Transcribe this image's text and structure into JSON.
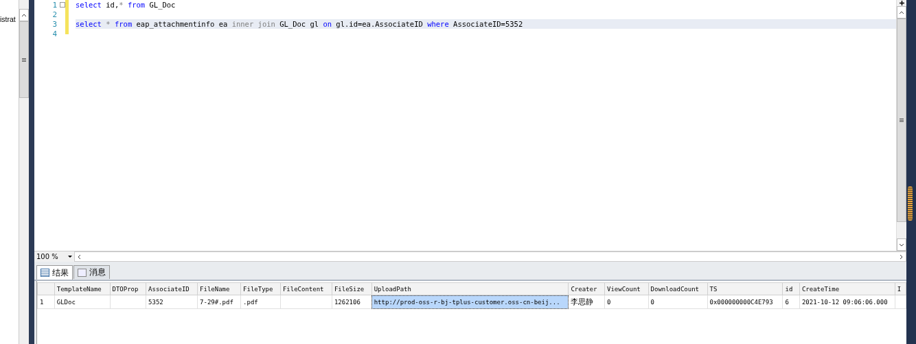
{
  "explorer": {
    "node_text": "istrat"
  },
  "editor": {
    "lines": [
      {
        "number": "1",
        "collapsible": true,
        "current": false,
        "tokens": [
          {
            "kind": "keyword",
            "text": "select"
          },
          {
            "kind": "plain",
            "text": " id,"
          },
          {
            "kind": "operator",
            "text": "* "
          },
          {
            "kind": "keyword",
            "text": "from"
          },
          {
            "kind": "plain",
            "text": " GL_Doc"
          }
        ]
      },
      {
        "number": "2",
        "collapsible": false,
        "current": false
      },
      {
        "number": "3",
        "collapsible": false,
        "current": true,
        "tokens": [
          {
            "kind": "keyword",
            "text": "select "
          },
          {
            "kind": "operator",
            "text": "* "
          },
          {
            "kind": "keyword",
            "text": "from"
          },
          {
            "kind": "plain",
            "text": " eap_attachmentinfo ea "
          },
          {
            "kind": "operator",
            "text": "inner join"
          },
          {
            "kind": "plain",
            "text": " GL_Doc gl "
          },
          {
            "kind": "keyword",
            "text": "on"
          },
          {
            "kind": "plain",
            "text": " gl.id=ea.AssociateID "
          },
          {
            "kind": "keyword",
            "text": "where"
          },
          {
            "kind": "plain",
            "text": " AssociateID=5352"
          }
        ]
      },
      {
        "number": "4",
        "collapsible": false,
        "current": false
      }
    ],
    "zoom": "100 %"
  },
  "result_tabs": [
    {
      "label": "结果",
      "kind": "grid",
      "selected": true
    },
    {
      "label": "消息",
      "kind": "messages",
      "selected": false
    }
  ],
  "grid": {
    "columns": [
      "TemplateName",
      "DTOProp",
      "AssociateID",
      "FileName",
      "FileType",
      "FileContent",
      "FileSize",
      "UploadPath",
      "Creater",
      "ViewCount",
      "DownloadCount",
      "TS",
      "id",
      "CreateTime",
      "I"
    ],
    "rows": [
      {
        "number": "1",
        "cells": [
          {
            "text": "GLDoc",
            "selected": false
          },
          {
            "text": "",
            "selected": false
          },
          {
            "text": "5352",
            "selected": false
          },
          {
            "text": "7-29#.pdf",
            "selected": false
          },
          {
            "text": ".pdf",
            "selected": false
          },
          {
            "text": "",
            "selected": false
          },
          {
            "text": "1262106",
            "selected": false
          },
          {
            "text": "http://prod-oss-r-bj-tplus-customer.oss-cn-beij...",
            "selected": true
          },
          {
            "text": "李思静",
            "selected": false
          },
          {
            "text": "0",
            "selected": false
          },
          {
            "text": "0",
            "selected": false
          },
          {
            "text": "0x000000000C4E793",
            "selected": false
          },
          {
            "text": "6",
            "selected": false
          },
          {
            "text": "2021-10-12 09:06:06.000",
            "selected": false
          },
          {
            "text": "",
            "selected": false
          }
        ]
      }
    ]
  }
}
